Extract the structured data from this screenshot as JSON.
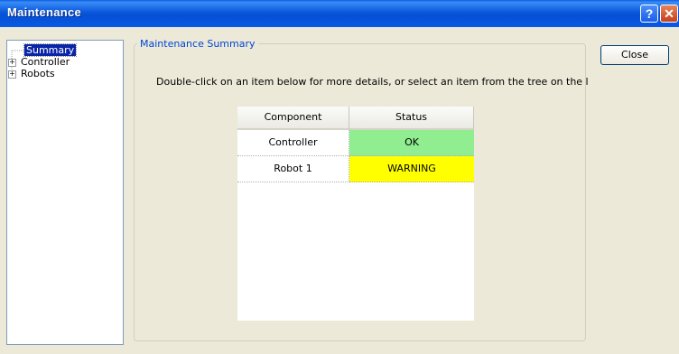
{
  "window": {
    "title": "Maintenance",
    "help_glyph": "?",
    "close_glyph": "✕"
  },
  "tree": {
    "items": [
      {
        "label": "Summary",
        "expandable": false,
        "selected": true
      },
      {
        "label": "Controller",
        "expandable": true,
        "expander": "+"
      },
      {
        "label": "Robots",
        "expandable": true,
        "expander": "+"
      }
    ]
  },
  "summary": {
    "group_label": "Maintenance Summary",
    "instructions": "Double-click on an item below for more details, or select an item from the tree on the lef",
    "columns": [
      "Component",
      "Status"
    ],
    "rows": [
      {
        "component": "Controller",
        "status": "OK",
        "status_color": "#90ee90"
      },
      {
        "component": "Robot 1",
        "status": "WARNING",
        "status_color": "#ffff00"
      }
    ]
  },
  "buttons": {
    "close_label": "Close"
  },
  "colors": {
    "titlebar": "#0a58dc",
    "selection": "#0a24a8",
    "group_label": "#0046d5"
  }
}
